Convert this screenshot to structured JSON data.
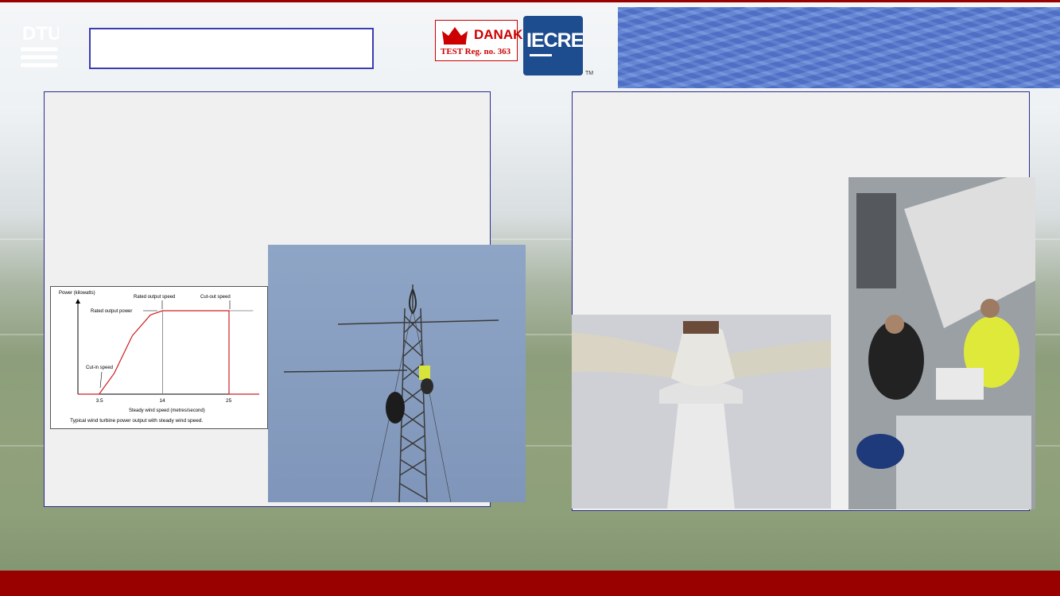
{
  "branding": {
    "logo_text": "DTU",
    "danak_name": "DANAK",
    "danak_reg": "TEST  Reg. no. 363",
    "iecre_text": "IECRE",
    "iecre_tm": "TM"
  },
  "photos": {
    "met_mast": "met-mast-climber-photo",
    "rotor": "turbine-rotor-photo",
    "nacelle": "nacelle-technicians-photo"
  },
  "chart_data": {
    "type": "line",
    "title": "",
    "ylabel": "Power (kilowatts)",
    "xlabel": "Steady wind speed (metres/second)",
    "caption": "Typical wind turbine power output with steady wind speed.",
    "annotations": {
      "rated_output_speed": "Rated output speed",
      "cut_out_speed": "Cut-out speed",
      "rated_output_power": "Rated output power",
      "cut_in_speed": "Cut-in speed"
    },
    "x_ticks": [
      "3.5",
      "14",
      "25"
    ],
    "series": [
      {
        "x": [
          0,
          3.5,
          6,
          9,
          12,
          14,
          25,
          25,
          30
        ],
        "y": [
          0,
          0,
          0.25,
          0.7,
          0.95,
          1,
          1,
          0,
          0
        ]
      }
    ],
    "xlim": [
      0,
      30
    ],
    "ylim": [
      0,
      1.2
    ],
    "line_color": "#cc2222"
  }
}
